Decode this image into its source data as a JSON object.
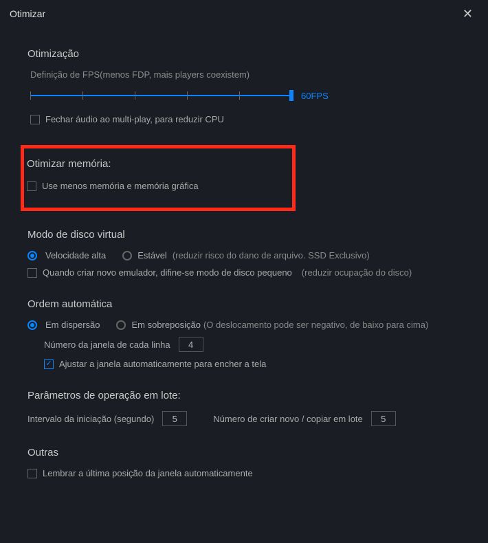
{
  "title": "Otimizar",
  "optimization": {
    "heading": "Otimização",
    "fps_label": "Definição de FPS(menos FDP, mais players coexistem)",
    "fps_value": "60FPS",
    "close_audio": "Fechar áudio ao multi-play, para reduzir CPU"
  },
  "memory": {
    "heading": "Otimizar memória:",
    "use_less": "Use menos memória e memória gráfica"
  },
  "disk": {
    "heading": "Modo de disco virtual",
    "high_speed": "Velocidade alta",
    "stable": "Estável",
    "stable_note": "(reduzir risco do dano de arquivo. SSD Exclusivo)",
    "small_disk": "Quando criar novo emulador, difine-se modo de disco pequeno",
    "small_disk_note": "(reduzir ocupação do disco)"
  },
  "auto_order": {
    "heading": "Ordem automática",
    "scatter": "Em dispersão",
    "overlap": "Em sobreposição",
    "overlap_note": "(O deslocamento pode ser negativo, de baixo para cima)",
    "per_line_label": "Número da janela de cada linha",
    "per_line_value": "4",
    "auto_fit": "Ajustar a janela automaticamente para encher a tela"
  },
  "batch": {
    "heading": "Parâmetros de operação em lote:",
    "interval_label": "Intervalo da iniciação (segundo)",
    "interval_value": "5",
    "copies_label": "Número de criar novo / copiar em lote",
    "copies_value": "5"
  },
  "other": {
    "heading": "Outras",
    "remember_pos": "Lembrar a última posição da janela automaticamente"
  }
}
